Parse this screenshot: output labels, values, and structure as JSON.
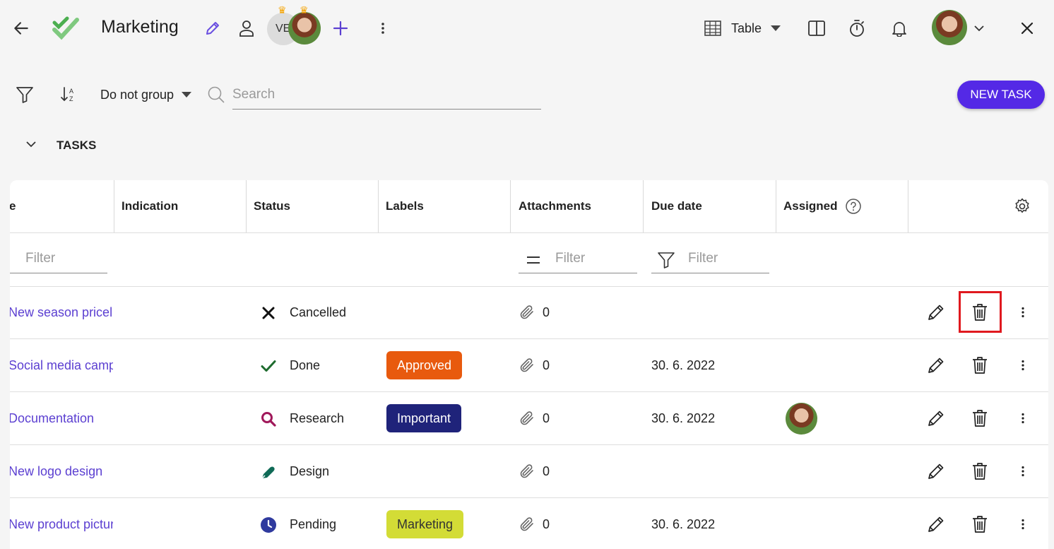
{
  "header": {
    "title": "Marketing",
    "member_initials": "VE",
    "view_label": "Table"
  },
  "toolbar": {
    "group_label": "Do not group",
    "search_placeholder": "Search",
    "new_task_label": "NEW TASK"
  },
  "section": {
    "title": "TASKS"
  },
  "table": {
    "columns": [
      "e",
      "Indication",
      "Status",
      "Labels",
      "Attachments",
      "Due date",
      "Assigned"
    ],
    "filter_placeholders": {
      "name": "Filter",
      "attachments": "Filter",
      "due_date": "Filter"
    },
    "rows": [
      {
        "name": "New season pricelis",
        "status": "Cancelled",
        "status_icon": "x-icon",
        "label": "",
        "attachments": "0",
        "due_date": "",
        "assigned": false
      },
      {
        "name": "Social media campa",
        "status": "Done",
        "status_icon": "check-icon",
        "label": "Approved",
        "attachments": "0",
        "due_date": "30. 6. 2022",
        "assigned": false
      },
      {
        "name": "Documentation",
        "status": "Research",
        "status_icon": "search-icon",
        "label": "Important",
        "attachments": "0",
        "due_date": "30. 6. 2022",
        "assigned": true
      },
      {
        "name": "New logo design",
        "status": "Design",
        "status_icon": "pen-icon",
        "label": "",
        "attachments": "0",
        "due_date": "",
        "assigned": false
      },
      {
        "name": "New product pictur",
        "status": "Pending",
        "status_icon": "clock-icon",
        "label": "Marketing",
        "attachments": "0",
        "due_date": "30. 6. 2022",
        "assigned": false
      }
    ]
  },
  "colors": {
    "accent": "#5429e6",
    "link": "#5b3fd1",
    "label_approved": "#e85a0e",
    "label_important": "#1f237a",
    "label_marketing": "#d3dc36",
    "highlight": "#e0191f"
  }
}
